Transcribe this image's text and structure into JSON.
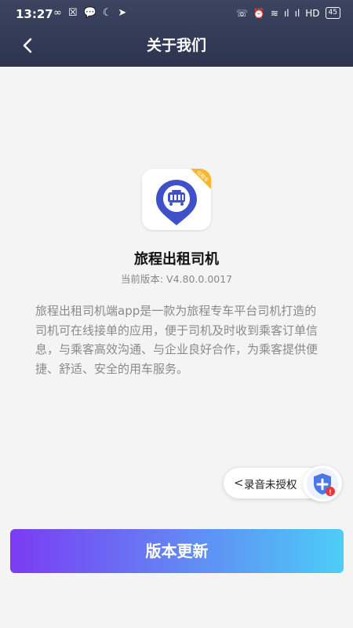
{
  "status_bar": {
    "time": "13:27",
    "left_icons": [
      "∞",
      "☒",
      "💬",
      "☾",
      "➤"
    ],
    "right_icons": [
      "☏",
      "⏰",
      "≋",
      "ıl",
      "ıl",
      "HD"
    ],
    "battery": "45"
  },
  "header": {
    "title": "关于我们",
    "back_icon": "chevron-left-icon"
  },
  "app": {
    "name": "旅程出租司机",
    "version": "当前版本: V4.80.0.0017",
    "badge_color": "#f5b731",
    "brand_color": "#3f51c8",
    "description": "旅程出租司机端app是一款为旅程专车平台司机打造的司机可在线接单的应用，便于司机及时收到乘客订单信息，与乘客高效沟通、与企业良好合作，为乘客提供便捷、舒适、安全的用车服务。"
  },
  "floating": {
    "chevron": "<",
    "label": "录音未授权"
  },
  "update_button": {
    "label": "版本更新"
  },
  "colors": {
    "header_bg": "#343c58",
    "button_start": "#7b3bf3",
    "button_end": "#4ccdf6"
  }
}
